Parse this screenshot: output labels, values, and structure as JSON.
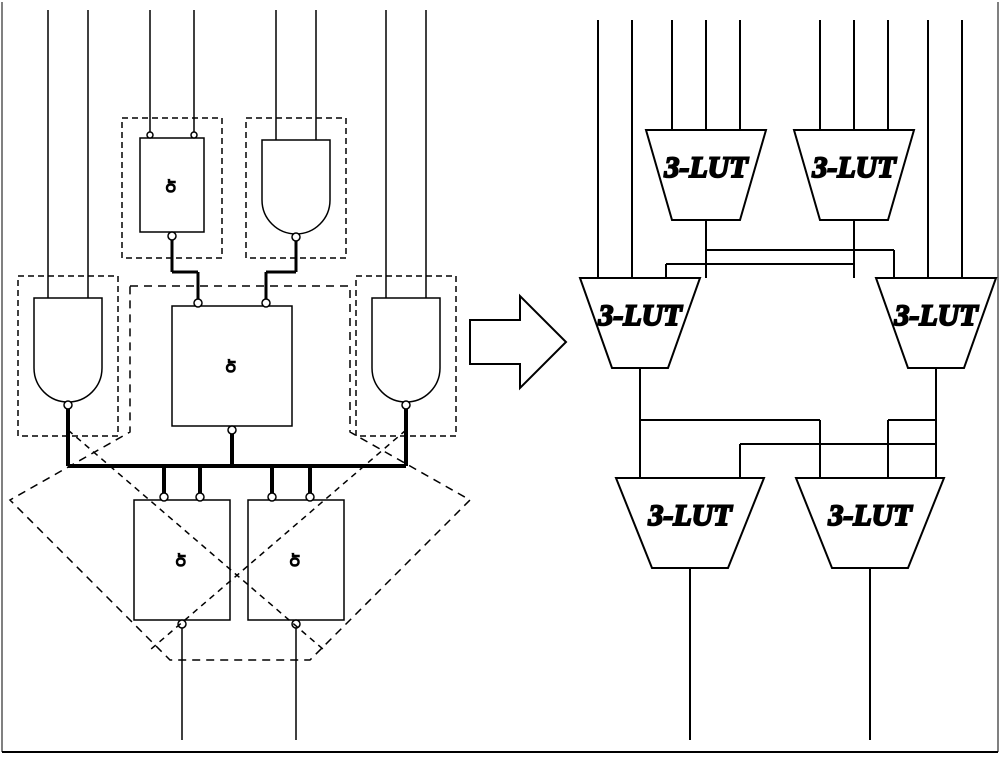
{
  "left_gates": {
    "g1": "Or",
    "g2": "",
    "g3": "",
    "g4": "Or",
    "g5": "",
    "g6": "Or",
    "g7": "Or"
  },
  "right_luts": {
    "lut1": "3-LUT",
    "lut2": "3-LUT",
    "lut3": "3-LUT",
    "lut4": "3-LUT",
    "lut5": "3-LUT",
    "lut6": "3-LUT"
  }
}
